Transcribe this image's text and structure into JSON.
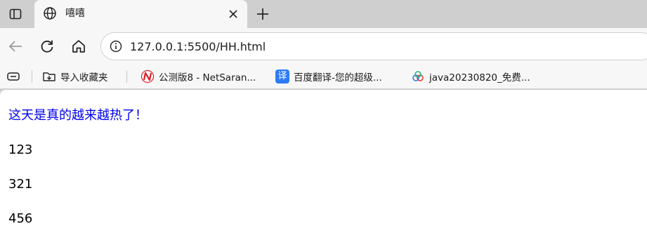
{
  "tab": {
    "title": "嘻嘻"
  },
  "address": {
    "url": "127.0.0.1:5500/HH.html"
  },
  "bookmarks": [
    {
      "label": "导入收藏夹",
      "icon": "import-favorites-icon"
    },
    {
      "label": "公测版8 - NetSaran...",
      "icon": "netsarang-icon"
    },
    {
      "label": "百度翻译-您的超级...",
      "icon": "baidu-translate-icon"
    },
    {
      "label": "java20230820_免费...",
      "icon": "cloud-drive-icon"
    }
  ],
  "page": {
    "headline": "这天是真的越来越热了！",
    "headline_color": "#0000ee",
    "lines": [
      "123",
      "321",
      "456"
    ]
  }
}
